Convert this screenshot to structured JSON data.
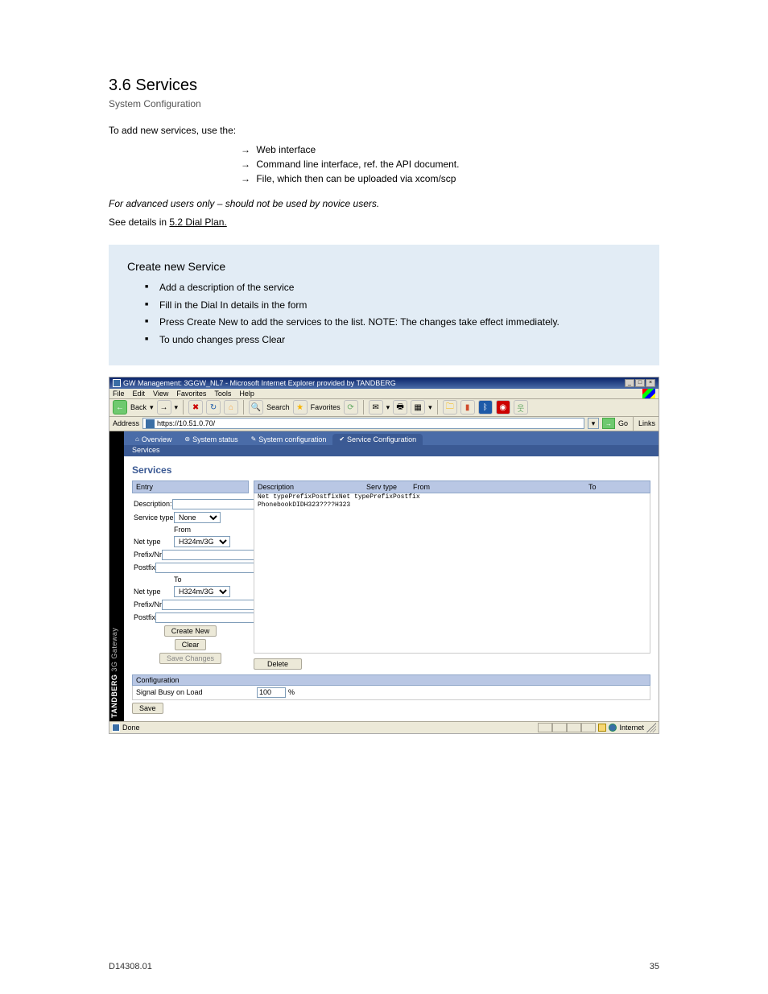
{
  "doc": {
    "title": "3.6 Services",
    "subtitle": "System Configuration",
    "para1": "To add new services, use the:",
    "arrow_items": [
      {
        "arrow": "→",
        "text": "Web interface"
      },
      {
        "arrow": "→",
        "text": "Command line interface, ref. the API document."
      },
      {
        "arrow": "→",
        "text": "File, which then can be uploaded via xcom/scp"
      }
    ],
    "para2": "For advanced users only – should not be used by novice users.",
    "para3_pre": "See details in ",
    "para3_link": "5.2 Dial Plan.",
    "note_title": "Create new Service",
    "notes": [
      "Add a description of the service",
      "Fill in the Dial In details in the form",
      "Press Create New to add the services to the list. NOTE: The changes take effect immediately.",
      "To undo changes press Clear"
    ],
    "footer_left": "D14308.01",
    "footer_right": "35"
  },
  "shot": {
    "window_title": "GW Management: 3GGW_NL7 - Microsoft Internet Explorer provided by TANDBERG",
    "win_btns": {
      "min": "_",
      "max": "□",
      "close": "×"
    },
    "menus": [
      "File",
      "Edit",
      "View",
      "Favorites",
      "Tools",
      "Help"
    ],
    "toolbar": {
      "back": "Back",
      "search": "Search",
      "favorites": "Favorites"
    },
    "address": {
      "label": "Address",
      "value": "https://10.51.0.70/",
      "go": "Go",
      "links": "Links"
    },
    "vbrand_a": "TANDBERG",
    "vbrand_b": " 3G Gateway",
    "tabs": [
      {
        "icon": "⌂",
        "label": "Overview"
      },
      {
        "icon": "⊚",
        "label": "System status"
      },
      {
        "icon": "✎",
        "label": "System configuration"
      },
      {
        "icon": "✔",
        "label": "Service Configuration",
        "active": true
      }
    ],
    "subbar": "Services",
    "section_title": "Services",
    "entry_header": "Entry",
    "form": {
      "description": "Description:",
      "servtype": "Service type",
      "servtype_val": "None",
      "from": "From",
      "nettype": "Net type",
      "nettype_val": "H324m/3G",
      "prefix": "Prefix/Nr",
      "postfix": "Postfix",
      "to": "To",
      "create": "Create New",
      "clear": "Clear",
      "savech": "Save Changes"
    },
    "table": {
      "h_desc": "Description",
      "h_servtype": "Serv type",
      "h_from": "From",
      "h_to": "To",
      "sh_nettype": "Net type",
      "sh_prefix": "Prefix",
      "sh_postfix": "Postfix",
      "row": {
        "desc": "Phonebook",
        "servtype": "DID",
        "from_net": "H323",
        "from_prefix": "????",
        "from_postfix": "",
        "to_net": "H323",
        "to_prefix": "",
        "to_postfix": ""
      },
      "delete": "Delete"
    },
    "config": {
      "header": "Configuration",
      "label": "Signal Busy on Load",
      "value": "100",
      "unit": "%",
      "save": "Save"
    },
    "status": {
      "done": "Done",
      "zone": "Internet"
    }
  }
}
